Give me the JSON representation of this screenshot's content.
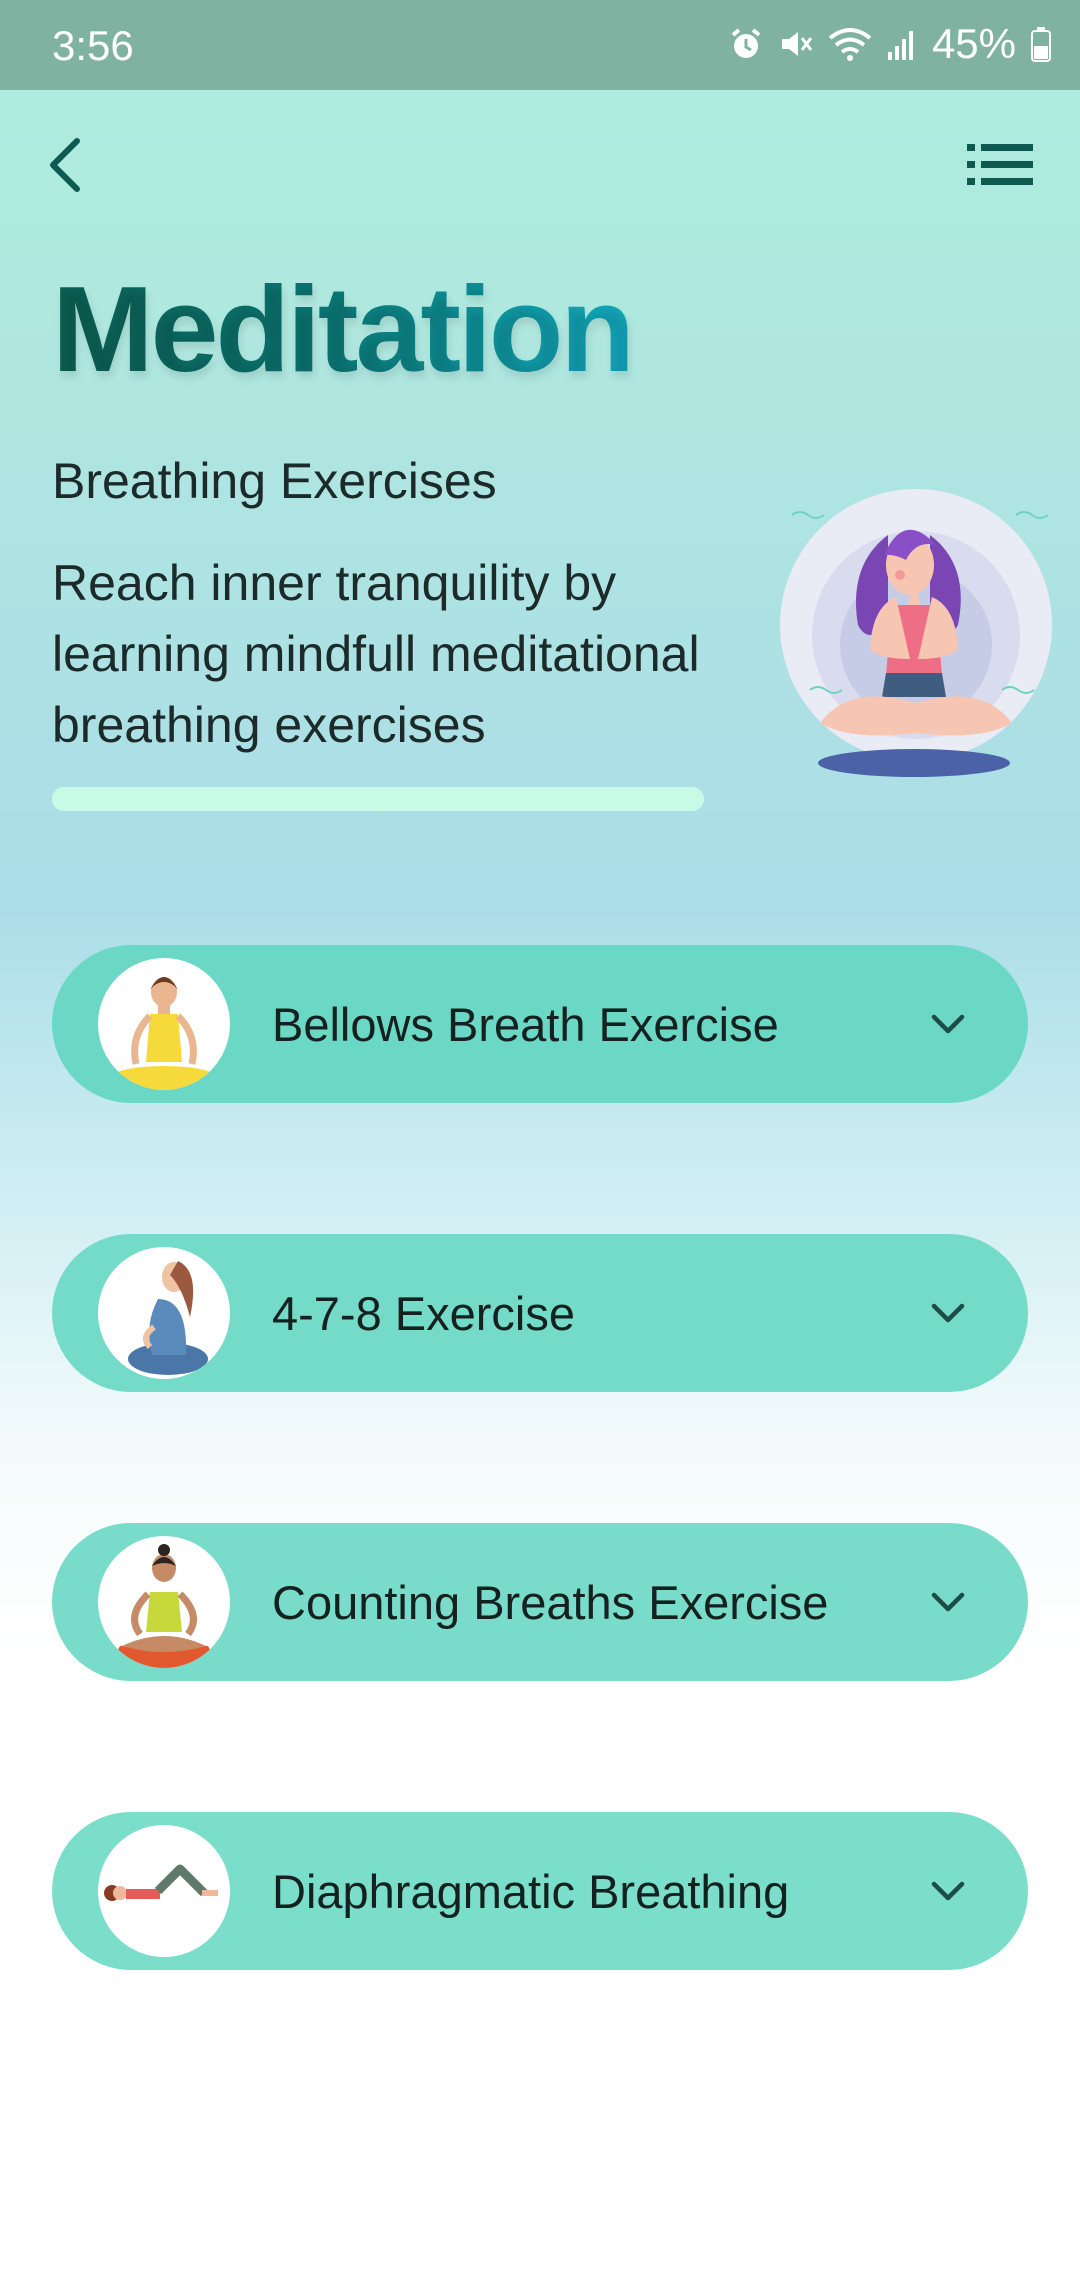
{
  "status_bar": {
    "time": "3:56",
    "battery": "45%",
    "icons": [
      "alarm-icon",
      "mute-icon",
      "wifi-icon",
      "signal-icon",
      "battery-icon"
    ]
  },
  "header": {
    "back_icon": "chevron-left-icon",
    "menu_icon": "list-menu-icon"
  },
  "page": {
    "title": "Meditation",
    "subtitle": "Breathing Exercises",
    "description": "Reach inner tranquility by learning mindfull meditational breathing exercises"
  },
  "progress": {
    "value": 1.0
  },
  "exercises": [
    {
      "label": "Bellows Breath Exercise",
      "icon": "lotus-pose-woman-yellow"
    },
    {
      "label": "4-7-8 Exercise",
      "icon": "seated-woman-side-view"
    },
    {
      "label": "Counting Breaths Exercise",
      "icon": "lotus-pose-woman-mat"
    },
    {
      "label": "Diaphragmatic Breathing",
      "icon": "lying-woman-knees-up"
    }
  ],
  "colors": {
    "status_bar": "#7fb2a0",
    "card": "#73dbc8",
    "title_dark": "#0b5e52",
    "title_light": "#12a9bd",
    "progress": "#c8fbe6"
  }
}
